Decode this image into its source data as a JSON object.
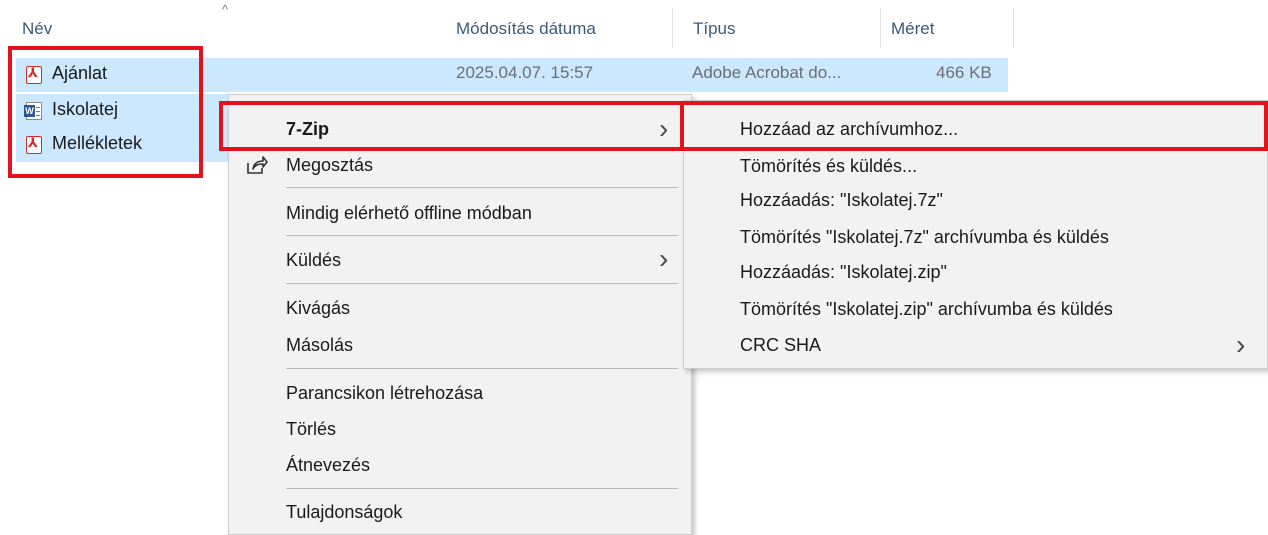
{
  "columns": {
    "name": "Név",
    "modified": "Módosítás dátuma",
    "type": "Típus",
    "size": "Méret"
  },
  "sort_indicator": "^",
  "files": [
    {
      "name": "Ajánlat",
      "icon": "pdf-icon",
      "modified": "2025.04.07. 15:57",
      "type": "Adobe Acrobat do...",
      "size": "466 KB"
    },
    {
      "name": "Iskolatej",
      "icon": "word-doc-icon"
    },
    {
      "name": "Mellékletek",
      "icon": "pdf-icon"
    }
  ],
  "context_menu": {
    "seven_zip": "7-Zip",
    "share": "Megosztás",
    "offline": "Mindig elérhető offline módban",
    "send_to": "Küldés",
    "cut": "Kivágás",
    "copy": "Másolás",
    "create_shortcut": "Parancsikon létrehozása",
    "delete": "Törlés",
    "rename": "Átnevezés",
    "properties": "Tulajdonságok"
  },
  "submenu_7zip": {
    "add_to_archive": "Hozzáad az archívumhoz...",
    "compress_and_email": "Tömörítés és küldés...",
    "add_7z": "Hozzáadás: \"Iskolatej.7z\"",
    "compress_7z_email": "Tömörítés \"Iskolatej.7z\" archívumba és küldés",
    "add_zip": "Hozzáadás: \"Iskolatej.zip\"",
    "compress_zip_email": "Tömörítés \"Iskolatej.zip\" archívumba és küldés",
    "crc_sha": "CRC SHA"
  },
  "chevron": "›",
  "colors": {
    "selection": "#cce8ff",
    "annotation_red": "#e5121b",
    "menu_bg": "#f2f2f2",
    "header_text": "#3b5a7a"
  }
}
